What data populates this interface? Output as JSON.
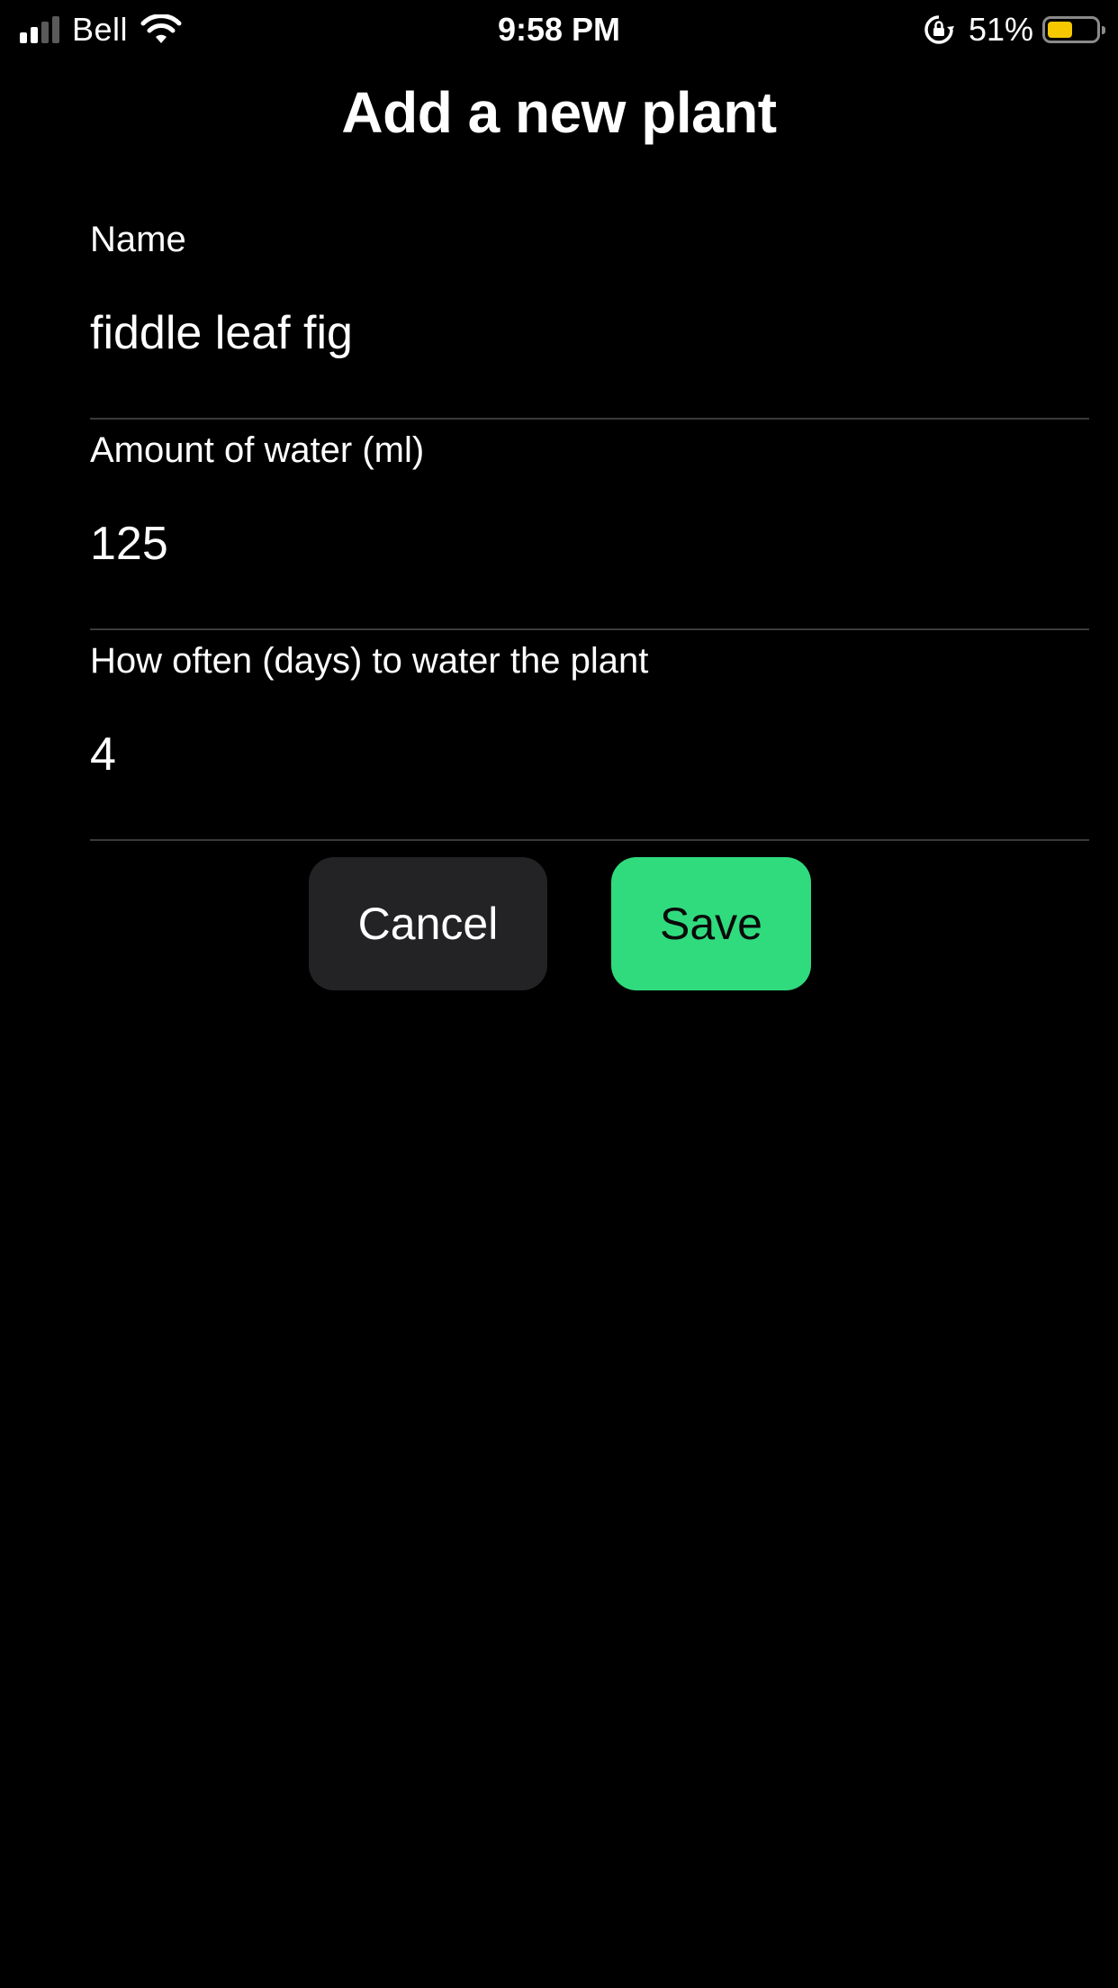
{
  "status_bar": {
    "carrier": "Bell",
    "time": "9:58 PM",
    "battery_percent": "51%",
    "battery_level": 0.51,
    "battery_color": "#f5c800",
    "signal_bars_active": 2,
    "signal_bars_total": 4,
    "icons": [
      "signal-icon",
      "wifi-icon",
      "orientation-lock-icon",
      "battery-icon"
    ]
  },
  "screen": {
    "title": "Add a new plant"
  },
  "form": {
    "name": {
      "label": "Name",
      "value": "fiddle leaf fig"
    },
    "water_amount": {
      "label": "Amount of water (ml)",
      "value": "125"
    },
    "frequency": {
      "label": "How often (days) to water the plant",
      "value": "4"
    }
  },
  "actions": {
    "cancel_label": "Cancel",
    "save_label": "Save",
    "save_color": "#30db7d",
    "cancel_color": "#232326"
  }
}
